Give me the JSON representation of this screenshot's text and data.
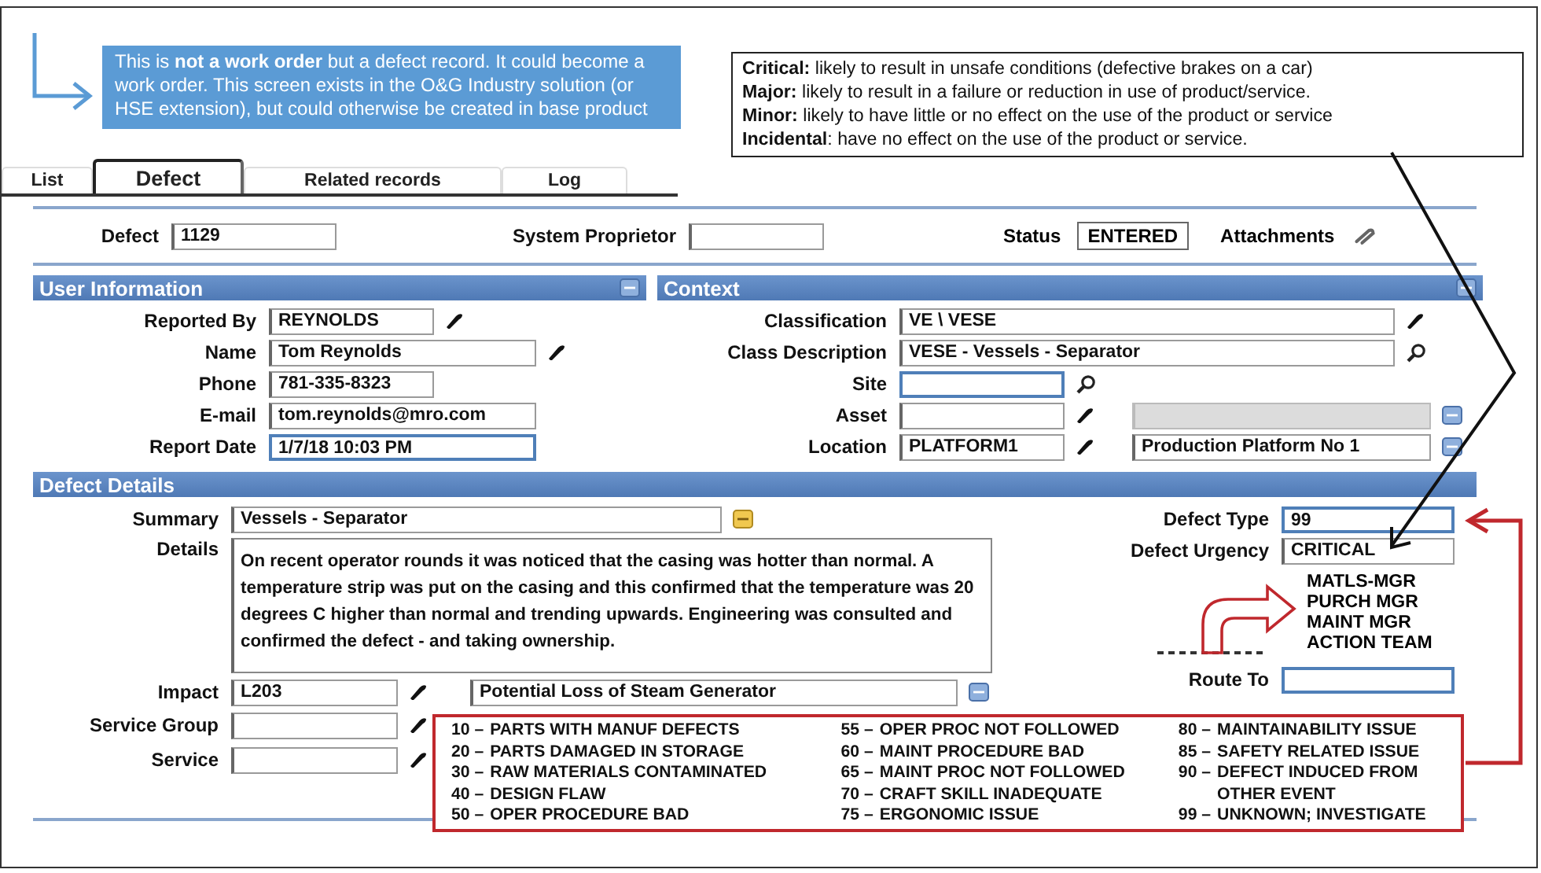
{
  "annotations": {
    "callout": "This is **not a work order** but a defect record. It  could become a work order. This screen exists in the O&G Industry solution (or HSE extension), but could otherwise be created in base product",
    "severity_legend": [
      "**Critical:** likely to result in unsafe conditions (defective brakes on a car)",
      "**Major:** likely to result in a failure or reduction in use of product/service.",
      "**Minor:** likely to have little or no effect on the use of the product or service",
      "**Incidental**: have no effect on the use of the product or service."
    ],
    "route_options": [
      "MATLS-MGR",
      "PURCH MGR",
      "MAINT MGR",
      "ACTION TEAM"
    ],
    "defect_type_codes": [
      [
        {
          "code": "10 –",
          "text": "PARTS WITH MANUF DEFECTS"
        },
        {
          "code": "20 –",
          "text": "PARTS DAMAGED IN STORAGE"
        },
        {
          "code": "30 –",
          "text": "RAW MATERIALS CONTAMINATED"
        },
        {
          "code": "40 –",
          "text": "DESIGN FLAW"
        },
        {
          "code": "50 –",
          "text": "OPER PROCEDURE BAD"
        }
      ],
      [
        {
          "code": "55 –",
          "text": "OPER PROC NOT FOLLOWED"
        },
        {
          "code": "60 –",
          "text": "MAINT PROCEDURE BAD"
        },
        {
          "code": "65 –",
          "text": "MAINT PROC NOT FOLLOWED"
        },
        {
          "code": "70 –",
          "text": "CRAFT SKILL INADEQUATE"
        },
        {
          "code": "75 –",
          "text": "ERGONOMIC  ISSUE"
        }
      ],
      [
        {
          "code": "80 –",
          "text": "MAINTAINABILITY ISSUE"
        },
        {
          "code": "85 –",
          "text": "SAFETY RELATED ISSUE"
        },
        {
          "code": "90 –",
          "text": "DEFECT INDUCED FROM OTHER EVENT"
        },
        {
          "code": "99 –",
          "text": "UNKNOWN; INVESTIGATE"
        }
      ]
    ]
  },
  "tabs": [
    {
      "label": "List",
      "selected": false
    },
    {
      "label": "Defect",
      "selected": true
    },
    {
      "label": "Related records",
      "selected": false
    },
    {
      "label": "Log",
      "selected": false
    }
  ],
  "header": {
    "defect": {
      "label": "Defect",
      "value": "1129",
      "highlighted": false
    },
    "system_proprietor": {
      "label": "System Proprietor",
      "highlighted": false
    },
    "status": {
      "label": "Status",
      "value": "ENTERED"
    },
    "attachments": {
      "label": "Attachments"
    }
  },
  "user_information": {
    "title": "User Information",
    "fields": [
      {
        "label": "Reported By",
        "value": "REYNOLDS",
        "kind": "lookup",
        "highlighted": false
      },
      {
        "label": "Name",
        "value": "Tom Reynolds",
        "kind": "lookup",
        "highlighted": false
      },
      {
        "label": "Phone",
        "value": "781-335-8323",
        "kind": "plain",
        "highlighted": false
      },
      {
        "label": "E-mail",
        "value": "tom.reynolds@mro.com",
        "kind": "plain",
        "highlighted": false
      },
      {
        "label": "Report Date",
        "value": "1/7/18 10:03 PM",
        "kind": "plain",
        "highlighted": true
      }
    ]
  },
  "context": {
    "title": "Context",
    "fields": [
      {
        "label": "Classification",
        "value": "VE \\ VESE",
        "kind": "lookup",
        "highlighted": false
      },
      {
        "label": "Class Description",
        "value": "VESE - Vessels - Separator",
        "kind": "search",
        "highlighted": false
      },
      {
        "label": "Site",
        "kind": "search",
        "highlighted": true
      },
      {
        "label": "Asset",
        "kind": "lookup",
        "highlighted": false,
        "description": {
          "readonly": true
        }
      },
      {
        "label": "Location",
        "value": "PLATFORM1",
        "kind": "lookup",
        "highlighted": false,
        "description": {
          "value": "Production Platform No 1",
          "readonly": false
        }
      }
    ]
  },
  "defect_details": {
    "title": "Defect Details",
    "summary": {
      "label": "Summary",
      "value": "Vessels - Separator",
      "kind": "note",
      "highlighted": false
    },
    "details": {
      "label": "Details",
      "value": "On recent operator rounds it was noticed that the casing was hotter than normal. A temperature strip was put on the casing and this confirmed that the temperature was 20 degrees C higher than normal and trending upwards. Engineering was consulted and confirmed the defect - and taking ownership."
    },
    "impact": {
      "label": "Impact",
      "value": "L203",
      "kind": "lookup",
      "highlighted": false,
      "description": {
        "value": "Potential Loss of Steam Generator",
        "readonly": false
      }
    },
    "service_group": {
      "label": "Service Group",
      "kind": "lookup",
      "highlighted": false
    },
    "service": {
      "label": "Service",
      "kind": "lookup",
      "highlighted": false
    },
    "defect_type": {
      "label": "Defect Type",
      "value": "99",
      "highlighted": true
    },
    "defect_urgency": {
      "label": "Defect Urgency",
      "value": "CRITICAL",
      "highlighted": false
    },
    "route_to": {
      "label": "Route To",
      "highlighted": true
    }
  }
}
